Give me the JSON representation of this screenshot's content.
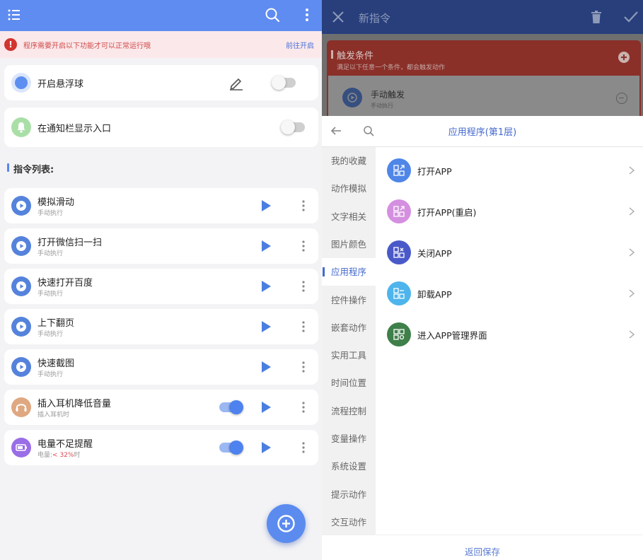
{
  "left": {
    "warning": {
      "text": "程序需要开启以下功能才可以正常运行哦",
      "link": "前往开启"
    },
    "floating_ball": {
      "label": "开启悬浮球",
      "enabled": false
    },
    "notification_entry": {
      "label": "在通知栏显示入口",
      "enabled": false
    },
    "section_title": "指令列表:",
    "commands": [
      {
        "title": "模拟滑动",
        "sub": "手动执行",
        "icon": "manual-trigger-icon",
        "toggle": null
      },
      {
        "title": "打开微信扫一扫",
        "sub": "手动执行",
        "icon": "manual-trigger-icon",
        "toggle": null
      },
      {
        "title": "快速打开百度",
        "sub": "手动执行",
        "icon": "manual-trigger-icon",
        "toggle": null
      },
      {
        "title": "上下翻页",
        "sub": "手动执行",
        "icon": "manual-trigger-icon",
        "toggle": null
      },
      {
        "title": "快速截图",
        "sub": "手动执行",
        "icon": "manual-trigger-icon",
        "toggle": null
      },
      {
        "title": "插入耳机降低音量",
        "sub": "插入耳机时",
        "icon": "headphone-icon",
        "toggle": true
      },
      {
        "title": "电量不足提醒",
        "sub_prefix": "电量:",
        "sub_value": "< 32%",
        "sub_suffix": "时",
        "icon": "battery-icon",
        "toggle": true
      }
    ]
  },
  "right": {
    "title": "新指令",
    "trigger": {
      "title": "触发条件",
      "sub": "满足以下任意一个条件，都会触发动作",
      "item": {
        "title": "手动触发",
        "sub": "手动执行"
      }
    },
    "sheet": {
      "title": "应用程序(第1层)",
      "categories": [
        "我的收藏",
        "动作模拟",
        "文字相关",
        "图片颜色",
        "应用程序",
        "控件操作",
        "嵌套动作",
        "实用工具",
        "时间位置",
        "流程控制",
        "变量操作",
        "系统设置",
        "提示动作",
        "交互动作"
      ],
      "active_category": "应用程序",
      "actions": [
        {
          "label": "打开APP",
          "color": "#4f86e8",
          "icon": "open-app-icon"
        },
        {
          "label": "打开APP(重启)",
          "color": "#d48fe0",
          "icon": "restart-app-icon"
        },
        {
          "label": "关闭APP",
          "color": "#4a59c9",
          "icon": "close-app-icon"
        },
        {
          "label": "卸载APP",
          "color": "#4db4ec",
          "icon": "uninstall-app-icon"
        },
        {
          "label": "进入APP管理界面",
          "color": "#3e7f4a",
          "icon": "app-manage-icon"
        }
      ],
      "footer": "返回保存"
    }
  },
  "colors": {
    "primary": "#5f8cf0",
    "dark_header": "#283f7c",
    "accent_blue": "#4469cf",
    "play_blue": "#4a7fe0",
    "warning_red": "#d2342f",
    "trigger_red": "#8b2f29"
  }
}
